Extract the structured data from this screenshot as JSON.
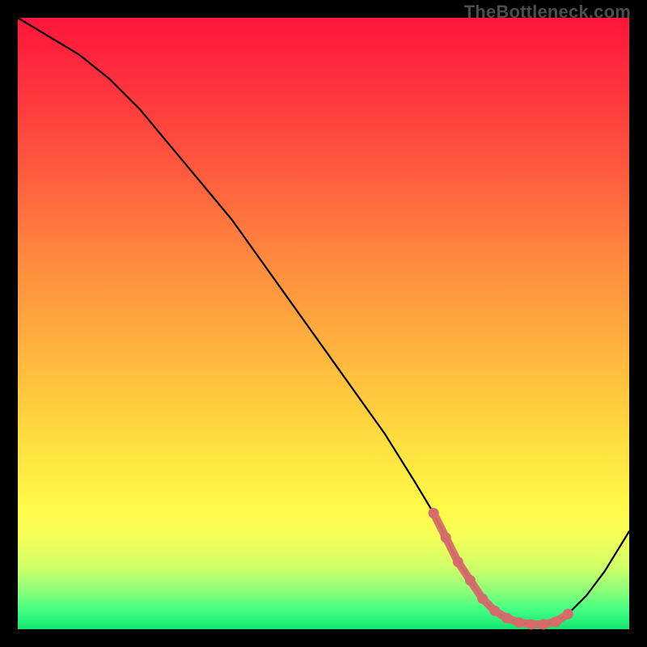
{
  "watermark": "TheBottleneck.com",
  "chart_data": {
    "type": "line",
    "title": "",
    "xlabel": "",
    "ylabel": "",
    "xlim": [
      0,
      100
    ],
    "ylim": [
      0,
      100
    ],
    "grid": false,
    "legend": false,
    "annotation": "Gradient background: red (top) → yellow → green (bottom). Black V-shaped curve with salmon-dotted valley segment.",
    "series": [
      {
        "name": "main-curve",
        "color": "#000000",
        "x": [
          0,
          5,
          10,
          15,
          20,
          25,
          30,
          35,
          40,
          45,
          50,
          55,
          60,
          65,
          68,
          70,
          72,
          74,
          76,
          78,
          80,
          82,
          84,
          86,
          88,
          90,
          93,
          96,
          100
        ],
        "y": [
          100,
          97,
          94,
          90,
          85,
          79,
          73,
          67,
          60,
          53,
          46,
          39,
          32,
          24,
          19,
          15,
          11,
          8,
          5,
          3,
          1.8,
          1.1,
          0.8,
          0.8,
          1.2,
          2.5,
          5.5,
          9.5,
          16
        ]
      },
      {
        "name": "valley-dots",
        "color": "#d76a6a",
        "x": [
          68,
          70,
          72,
          74,
          76,
          78,
          80,
          82,
          84,
          86,
          88,
          90
        ],
        "y": [
          19,
          15,
          11,
          8,
          5,
          3,
          1.8,
          1.1,
          0.8,
          0.8,
          1.2,
          2.5
        ]
      }
    ]
  }
}
